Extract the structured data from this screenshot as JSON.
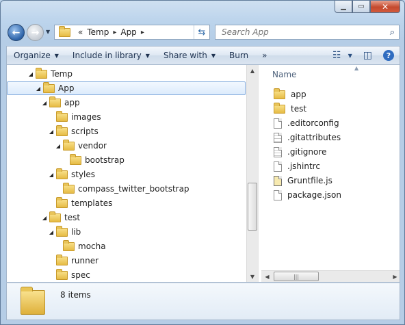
{
  "address": {
    "overflow": "«",
    "crumbs": [
      "Temp",
      "App"
    ]
  },
  "search": {
    "placeholder": "Search App"
  },
  "toolbar": {
    "organize": "Organize",
    "include": "Include in library",
    "share": "Share with",
    "burn": "Burn",
    "more": "»"
  },
  "tree": [
    {
      "label": "Temp",
      "depth": 0,
      "expanded": true
    },
    {
      "label": "App",
      "depth": 1,
      "expanded": true,
      "selected": true
    },
    {
      "label": "app",
      "depth": 2,
      "expanded": true
    },
    {
      "label": "images",
      "depth": 3,
      "expanded": false
    },
    {
      "label": "scripts",
      "depth": 3,
      "expanded": true
    },
    {
      "label": "vendor",
      "depth": 4,
      "expanded": true
    },
    {
      "label": "bootstrap",
      "depth": 5,
      "expanded": false
    },
    {
      "label": "styles",
      "depth": 3,
      "expanded": true
    },
    {
      "label": "compass_twitter_bootstrap",
      "depth": 4,
      "expanded": false
    },
    {
      "label": "templates",
      "depth": 3,
      "expanded": false
    },
    {
      "label": "test",
      "depth": 2,
      "expanded": true
    },
    {
      "label": "lib",
      "depth": 3,
      "expanded": true
    },
    {
      "label": "mocha",
      "depth": 4,
      "expanded": false
    },
    {
      "label": "runner",
      "depth": 3,
      "expanded": false
    },
    {
      "label": "spec",
      "depth": 3,
      "expanded": false
    }
  ],
  "file_list": {
    "column": "Name",
    "items": [
      {
        "name": "app",
        "kind": "folder-icon"
      },
      {
        "name": "test",
        "kind": "folder-icon"
      },
      {
        "name": ".editorconfig",
        "kind": "file-icon"
      },
      {
        "name": ".gitattributes",
        "kind": "text-file-icon"
      },
      {
        "name": ".gitignore",
        "kind": "text-file-icon"
      },
      {
        "name": ".jshintrc",
        "kind": "file-icon"
      },
      {
        "name": "Gruntfile.js",
        "kind": "script-file-icon"
      },
      {
        "name": "package.json",
        "kind": "file-icon"
      }
    ]
  },
  "status": {
    "count": "8 items"
  }
}
